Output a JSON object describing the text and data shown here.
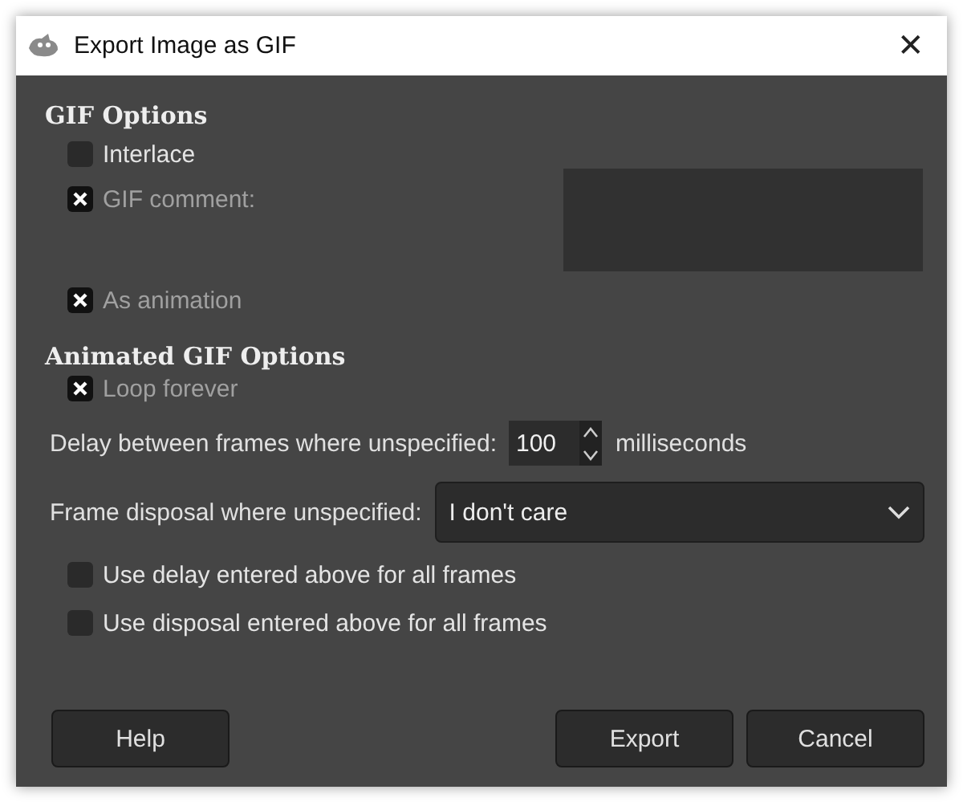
{
  "window": {
    "title": "Export Image as GIF",
    "close": "✕"
  },
  "gif_options": {
    "heading": "GIF Options",
    "interlace": {
      "label": "Interlace",
      "checked": false,
      "disabled": false
    },
    "gif_comment": {
      "label": "GIF comment:",
      "checked": true,
      "disabled": true
    },
    "as_animation": {
      "label": "As animation",
      "checked": true,
      "disabled": true
    }
  },
  "animated_options": {
    "heading": "Animated GIF Options",
    "loop_forever": {
      "label": "Loop forever",
      "checked": true,
      "disabled": true
    },
    "delay": {
      "label": "Delay between frames where unspecified:",
      "value": "100",
      "unit": "milliseconds"
    },
    "disposal": {
      "label": "Frame disposal where unspecified:",
      "value": "I don't care"
    },
    "checkboxes": [
      {
        "label": "Use delay entered above for all frames",
        "checked": false,
        "disabled": false
      },
      {
        "label": "Use disposal entered above for all frames",
        "checked": false,
        "disabled": false
      }
    ]
  },
  "buttons": {
    "left": [
      "Help"
    ],
    "right": [
      "Export",
      "Cancel"
    ]
  }
}
